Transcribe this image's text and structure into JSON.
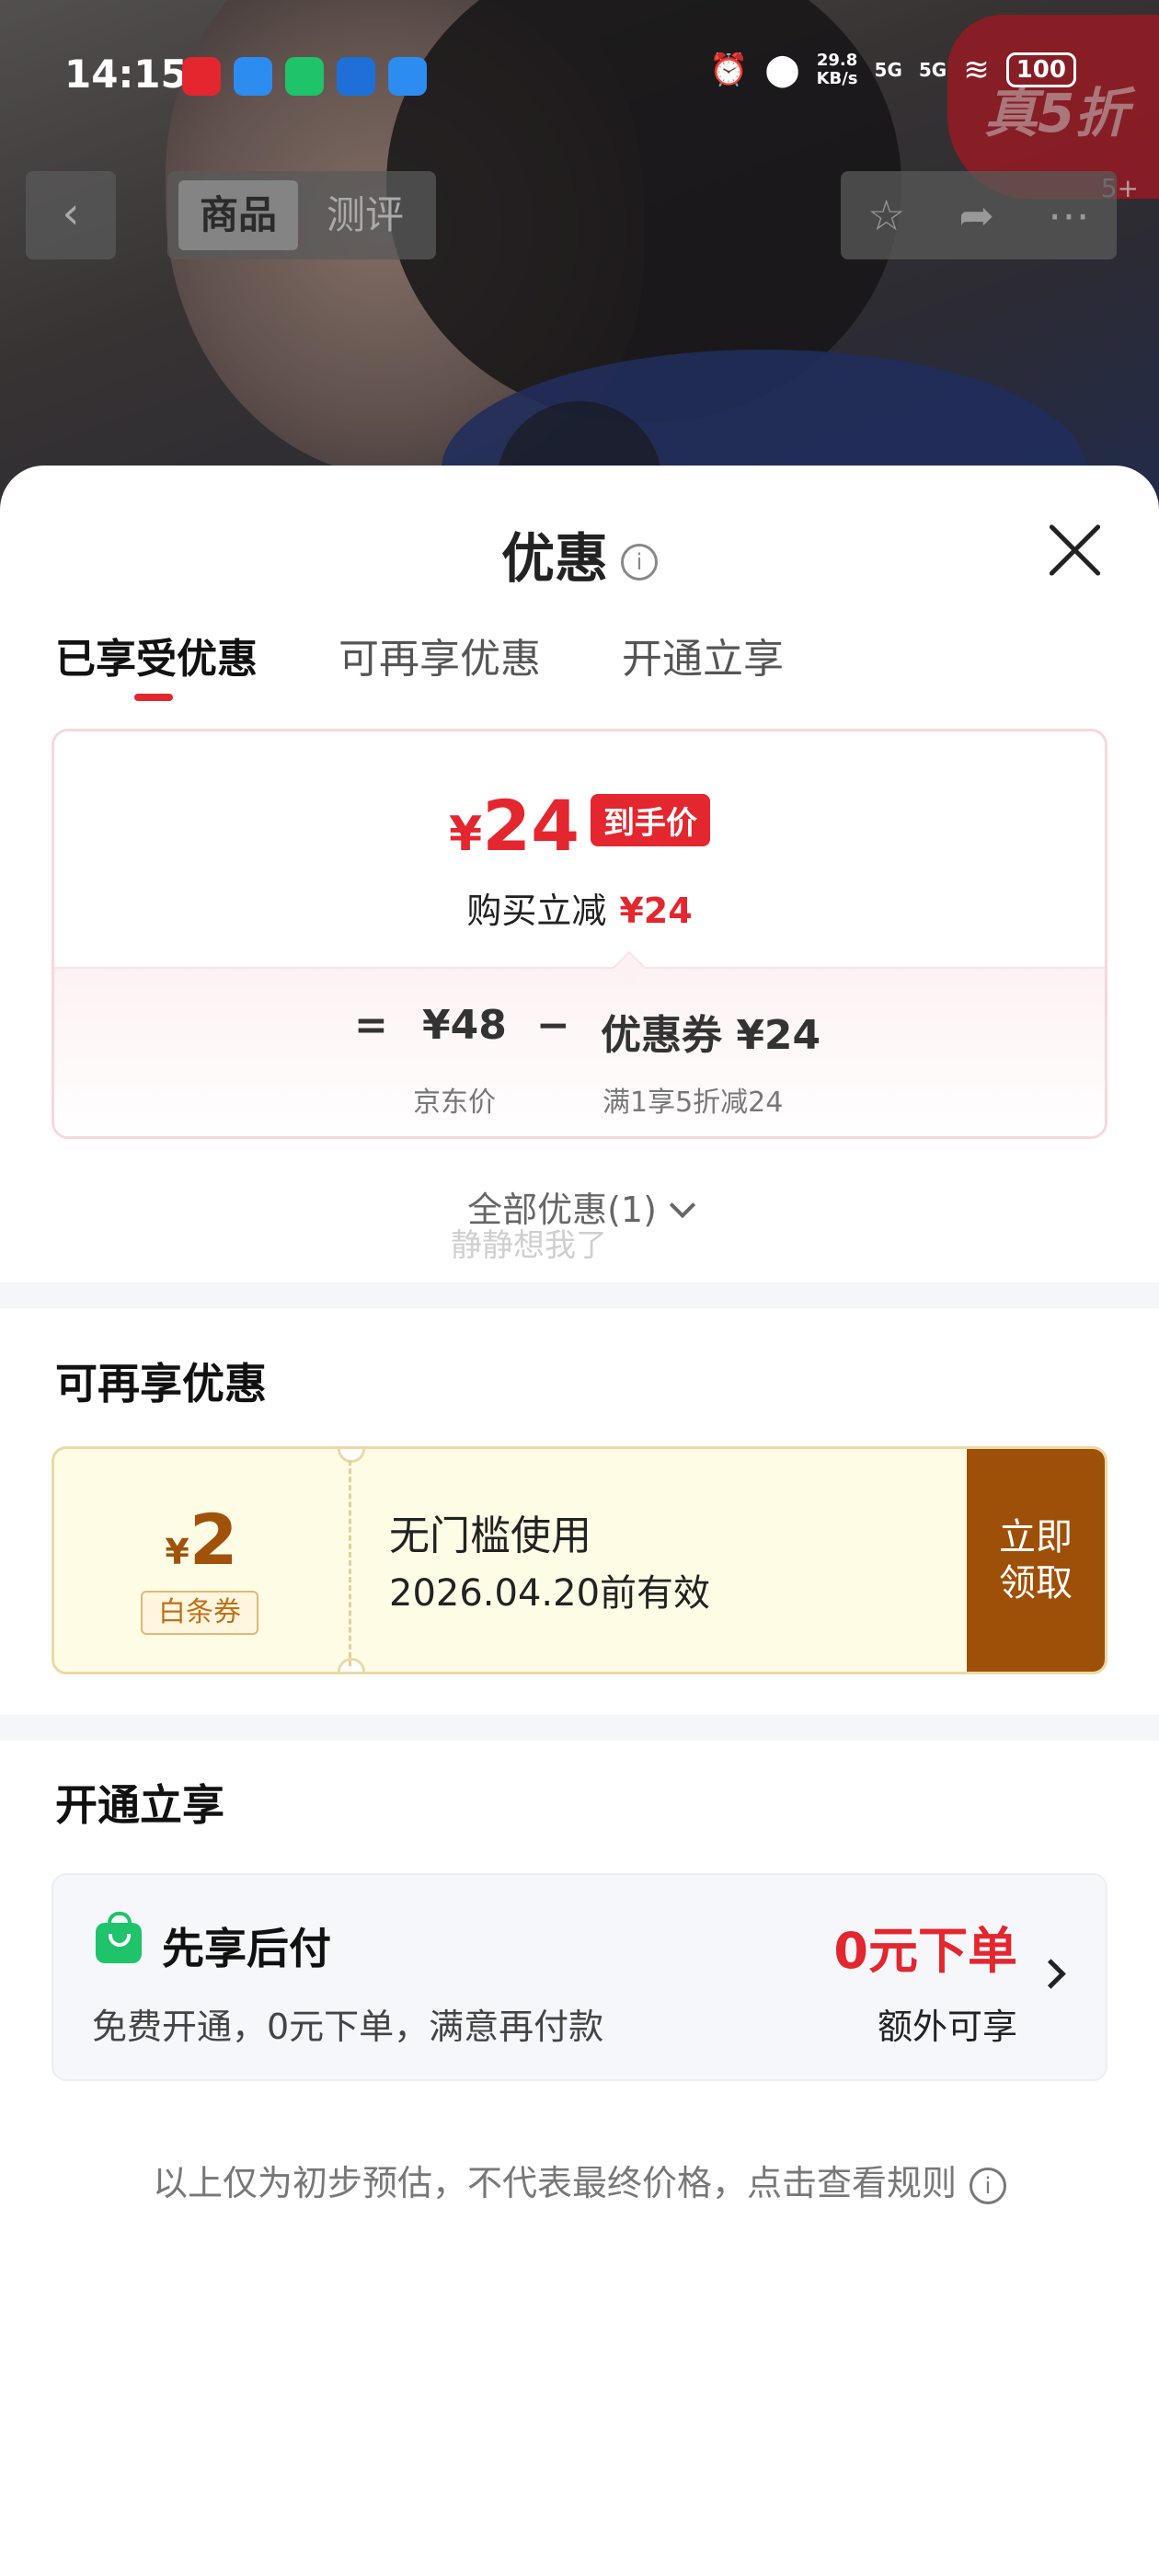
{
  "status_bar": {
    "time": "14:15",
    "net_speed_value": "29.8",
    "net_speed_unit": "KB/s",
    "signal_1": "5G",
    "signal_2": "5G",
    "battery": "100",
    "app_icon_colors": [
      "#e4262f",
      "#2d8cf0",
      "#1fc36a",
      "#1f6fd8",
      "#2d8cf0"
    ]
  },
  "product_nav": {
    "back_glyph": "‹",
    "tabs": [
      "商品",
      "测评"
    ],
    "active_tab": 0,
    "badge_text": "真5折",
    "badge_count": "5+"
  },
  "sheet": {
    "title": "优惠",
    "tabs": [
      {
        "label": "已享受优惠",
        "active": true
      },
      {
        "label": "可再享优惠",
        "active": false
      },
      {
        "label": "开通立享",
        "active": false
      }
    ],
    "price_card": {
      "currency": "¥",
      "final_price": "24",
      "final_tag": "到手价",
      "instant_label": "购买立减",
      "instant_value": "¥24",
      "eq_sign": "=",
      "jd_price": "¥48",
      "jd_price_label": "京东价",
      "minus_sign": "−",
      "coupon_label": "优惠券 ¥24",
      "coupon_rule": "满1享5折减24"
    },
    "all_discounts": "全部优惠(1)",
    "watermark": "静静想我了",
    "more_section": {
      "title": "可再享优惠",
      "coupon": {
        "currency": "¥",
        "amount": "2",
        "type": "白条券",
        "desc": "无门槛使用",
        "valid": "2026.04.20前有效",
        "btn_line1": "立即",
        "btn_line2": "领取"
      }
    },
    "open_section": {
      "title": "开通立享",
      "paylater": {
        "title": "先享后付",
        "desc": "免费开通，0元下单，满意再付款",
        "highlight": "0元下单",
        "extra": "额外可享"
      }
    },
    "footnote": "以上仅为初步预估，不代表最终价格，点击查看规则"
  },
  "colors": {
    "accent_red": "#e4262f",
    "coupon_brown": "#9f5008",
    "paylater_green": "#1fc36a"
  }
}
